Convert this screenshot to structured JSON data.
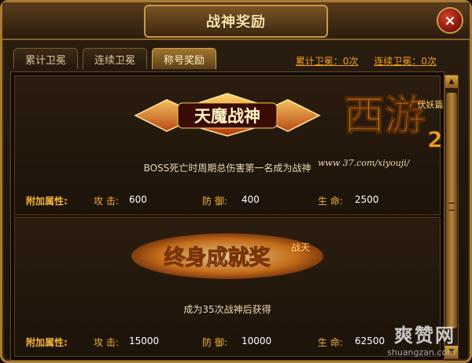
{
  "window": {
    "title": "战神奖励",
    "close_icon": "×"
  },
  "tabs": [
    {
      "label": "累计卫冕"
    },
    {
      "label": "连续卫冕"
    },
    {
      "label": "称号奖励"
    }
  ],
  "active_tab_index": 2,
  "stats": {
    "cumulative": "累计卫冕：0次",
    "consecutive": "连续卫冕：0次"
  },
  "cards": [
    {
      "banner_title": "天魔战神",
      "description": "BOSS死亡时周期总伤害第一名成为战神",
      "attr_label": "附加属性:",
      "attack_label": "攻 击:",
      "attack_value": "600",
      "defense_label": "防 御:",
      "defense_value": "400",
      "life_label": "生 命:",
      "life_value": "2500"
    },
    {
      "banner_title": "终身成就奖",
      "banner_badge": "战天",
      "description": "成为35次战神后获得",
      "attr_label": "附加属性:",
      "attack_label": "攻 击:",
      "attack_value": "15000",
      "defense_label": "防 御:",
      "defense_value": "10000",
      "life_label": "生 命:",
      "life_value": "62500"
    }
  ],
  "logo": {
    "main": "西游",
    "sub": "伏妖篇",
    "num": "2",
    "url": "www 37.com/xiyouji/"
  },
  "watermark": {
    "main": "爽赞网",
    "sub": "shuangzan.com"
  },
  "colors": {
    "accent": "#f3b43a",
    "value": "#ffffff",
    "stat": "#f0a020",
    "frame": "#a97a34"
  },
  "icons": {
    "scroll_up": "▲",
    "scroll_down": "▼"
  }
}
